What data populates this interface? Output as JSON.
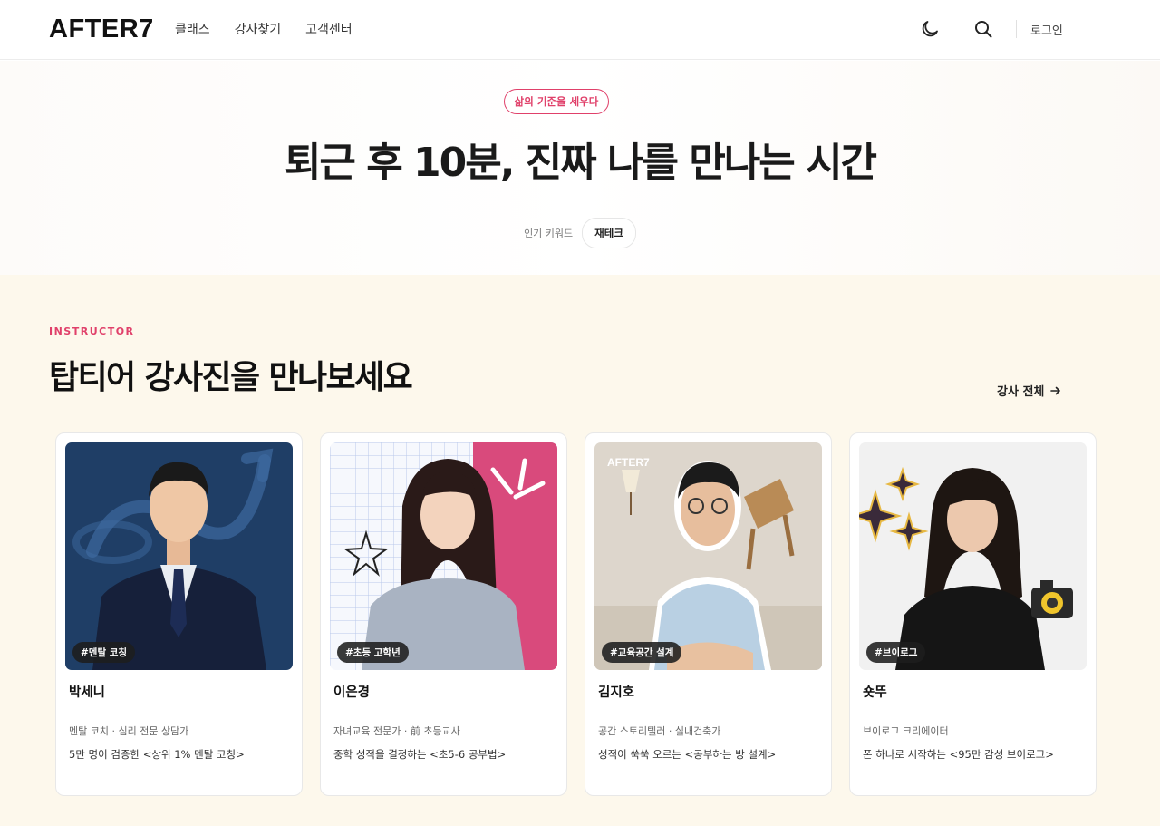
{
  "header": {
    "logo": "AFTER7",
    "nav": [
      "클래스",
      "강사찾기",
      "고객센터"
    ],
    "login": "로그인",
    "icons": [
      "moon-icon",
      "search-icon"
    ]
  },
  "hero": {
    "badge": "삶의 기준을 세우다",
    "title": "퇴근 후 10분, 진짜 나를 만나는 시간",
    "keyword_label": "인기 키워드",
    "keyword": "재테크"
  },
  "instructors": {
    "eyebrow": "INSTRUCTOR",
    "title": "탑티어 강사진을 만나보세요",
    "view_all": "강사 전체",
    "cards": [
      {
        "tag": "#멘탈 코칭",
        "name": "박세니",
        "role": "멘탈 코치 · 심리 전문 상담가",
        "desc": "5만 명이 검증한 <상위 1% 멘탈 코칭>"
      },
      {
        "tag": "#초등 고학년",
        "name": "이은경",
        "role": "자녀교육 전문가 · 前 초등교사",
        "desc": "중학 성적을 결정하는 <초5-6 공부법>"
      },
      {
        "tag": "#교육공간 설계",
        "name": "김지호",
        "role": "공간 스토리텔러 · 실내건축가",
        "desc": "성적이 쑥쑥 오르는 <공부하는 방 설계>",
        "photo_mark": "AFTER7"
      },
      {
        "tag": "#브이로그",
        "name": "숏뚜",
        "role": "브이로그 크리에이터",
        "desc": "폰 하나로 시작하는 <95만 감성 브이로그>"
      }
    ]
  },
  "colors": {
    "accent": "#e0406a",
    "section_bg": "#fdf8ec"
  }
}
